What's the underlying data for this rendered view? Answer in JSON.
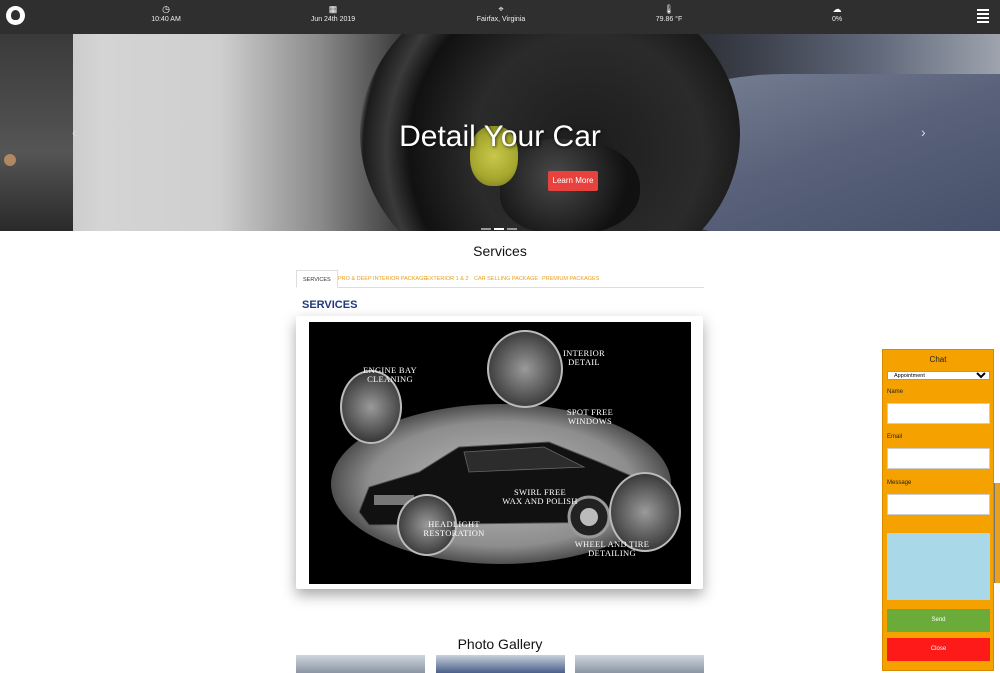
{
  "topbar": {
    "logo_icon": "github-icon",
    "time": "10:40 AM",
    "date": "Jun 24th 2019",
    "location": "Fairfax, Virginia",
    "temperature": "79.86 °F",
    "precipitation": "0%",
    "icons": {
      "time": "clock-icon",
      "date": "calendar-icon",
      "location": "crosshair-icon",
      "temperature": "thermometer-icon",
      "precipitation": "rain-cloud-icon",
      "menu": "hamburger-menu-icon"
    }
  },
  "hero": {
    "title": "Detail Your Car",
    "button_label": "Learn More",
    "prev_arrow": "‹",
    "next_arrow": "›",
    "slide_count": 3,
    "active_slide": 2
  },
  "services": {
    "heading": "Services",
    "tabs": [
      {
        "label": "SERVICES",
        "active": true
      },
      {
        "label": "PRO & DEEP INTERIOR PACKAGE",
        "active": false
      },
      {
        "label": "EXTERIOR 1 & 2",
        "active": false
      },
      {
        "label": "CAR SELLING PACKAGE",
        "active": false
      },
      {
        "label": "PREMIUM PACKAGES",
        "active": false
      }
    ],
    "panel_title": "SERVICES",
    "image_labels": {
      "engine": "ENGINE BAY\nCLEANING",
      "interior": "INTERIOR\nDETAIL",
      "windows": "SPOT FREE\nWINDOWS",
      "wax": "SWIRL FREE\nWAX AND POLISH",
      "headlight": "HEADLIGHT\nRESTORATION",
      "wheel": "WHEEL AND TIRE\nDETAILING"
    }
  },
  "gallery": {
    "heading": "Photo Gallery"
  },
  "chat": {
    "title": "Chat",
    "select_value": "Appointment",
    "name_label": "Name",
    "email_label": "Email",
    "message_label": "Message",
    "send_label": "Send",
    "close_label": "Close",
    "send_color": "#6aab3a",
    "close_color": "#ff1a1a"
  },
  "colors": {
    "topbar": "#2f2f2f",
    "accent_red": "#e8423e",
    "tab_orange": "#e8a020",
    "panel_title": "#1f3a7a",
    "chat_bg": "#f5a200"
  }
}
